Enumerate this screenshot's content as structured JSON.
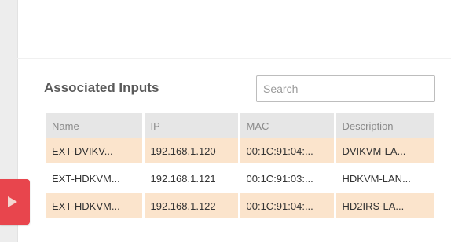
{
  "associated_inputs": {
    "title": "Associated Inputs",
    "search_placeholder": "Search",
    "search_value": "",
    "columns": {
      "name": "Name",
      "ip": "IP",
      "mac": "MAC",
      "description": "Description"
    },
    "rows": [
      {
        "name": "EXT-DVIKV...",
        "ip": "192.168.1.120",
        "mac": "00:1C:91:04:...",
        "description": "DVIKVM-LA..."
      },
      {
        "name": "EXT-HDKVM...",
        "ip": "192.168.1.121",
        "mac": "00:1C:91:03:...",
        "description": "HDKVM-LAN..."
      },
      {
        "name": "EXT-HDKVM...",
        "ip": "192.168.1.122",
        "mac": "00:1C:91:04:...",
        "description": "HD2IRS-LA..."
      }
    ]
  },
  "colors": {
    "highlight_row": "#fbe4cc",
    "header_bg": "#e6e6e6",
    "accent_tab": "#e8454d"
  },
  "icons": {
    "side_tab": "play-arrow-icon"
  }
}
